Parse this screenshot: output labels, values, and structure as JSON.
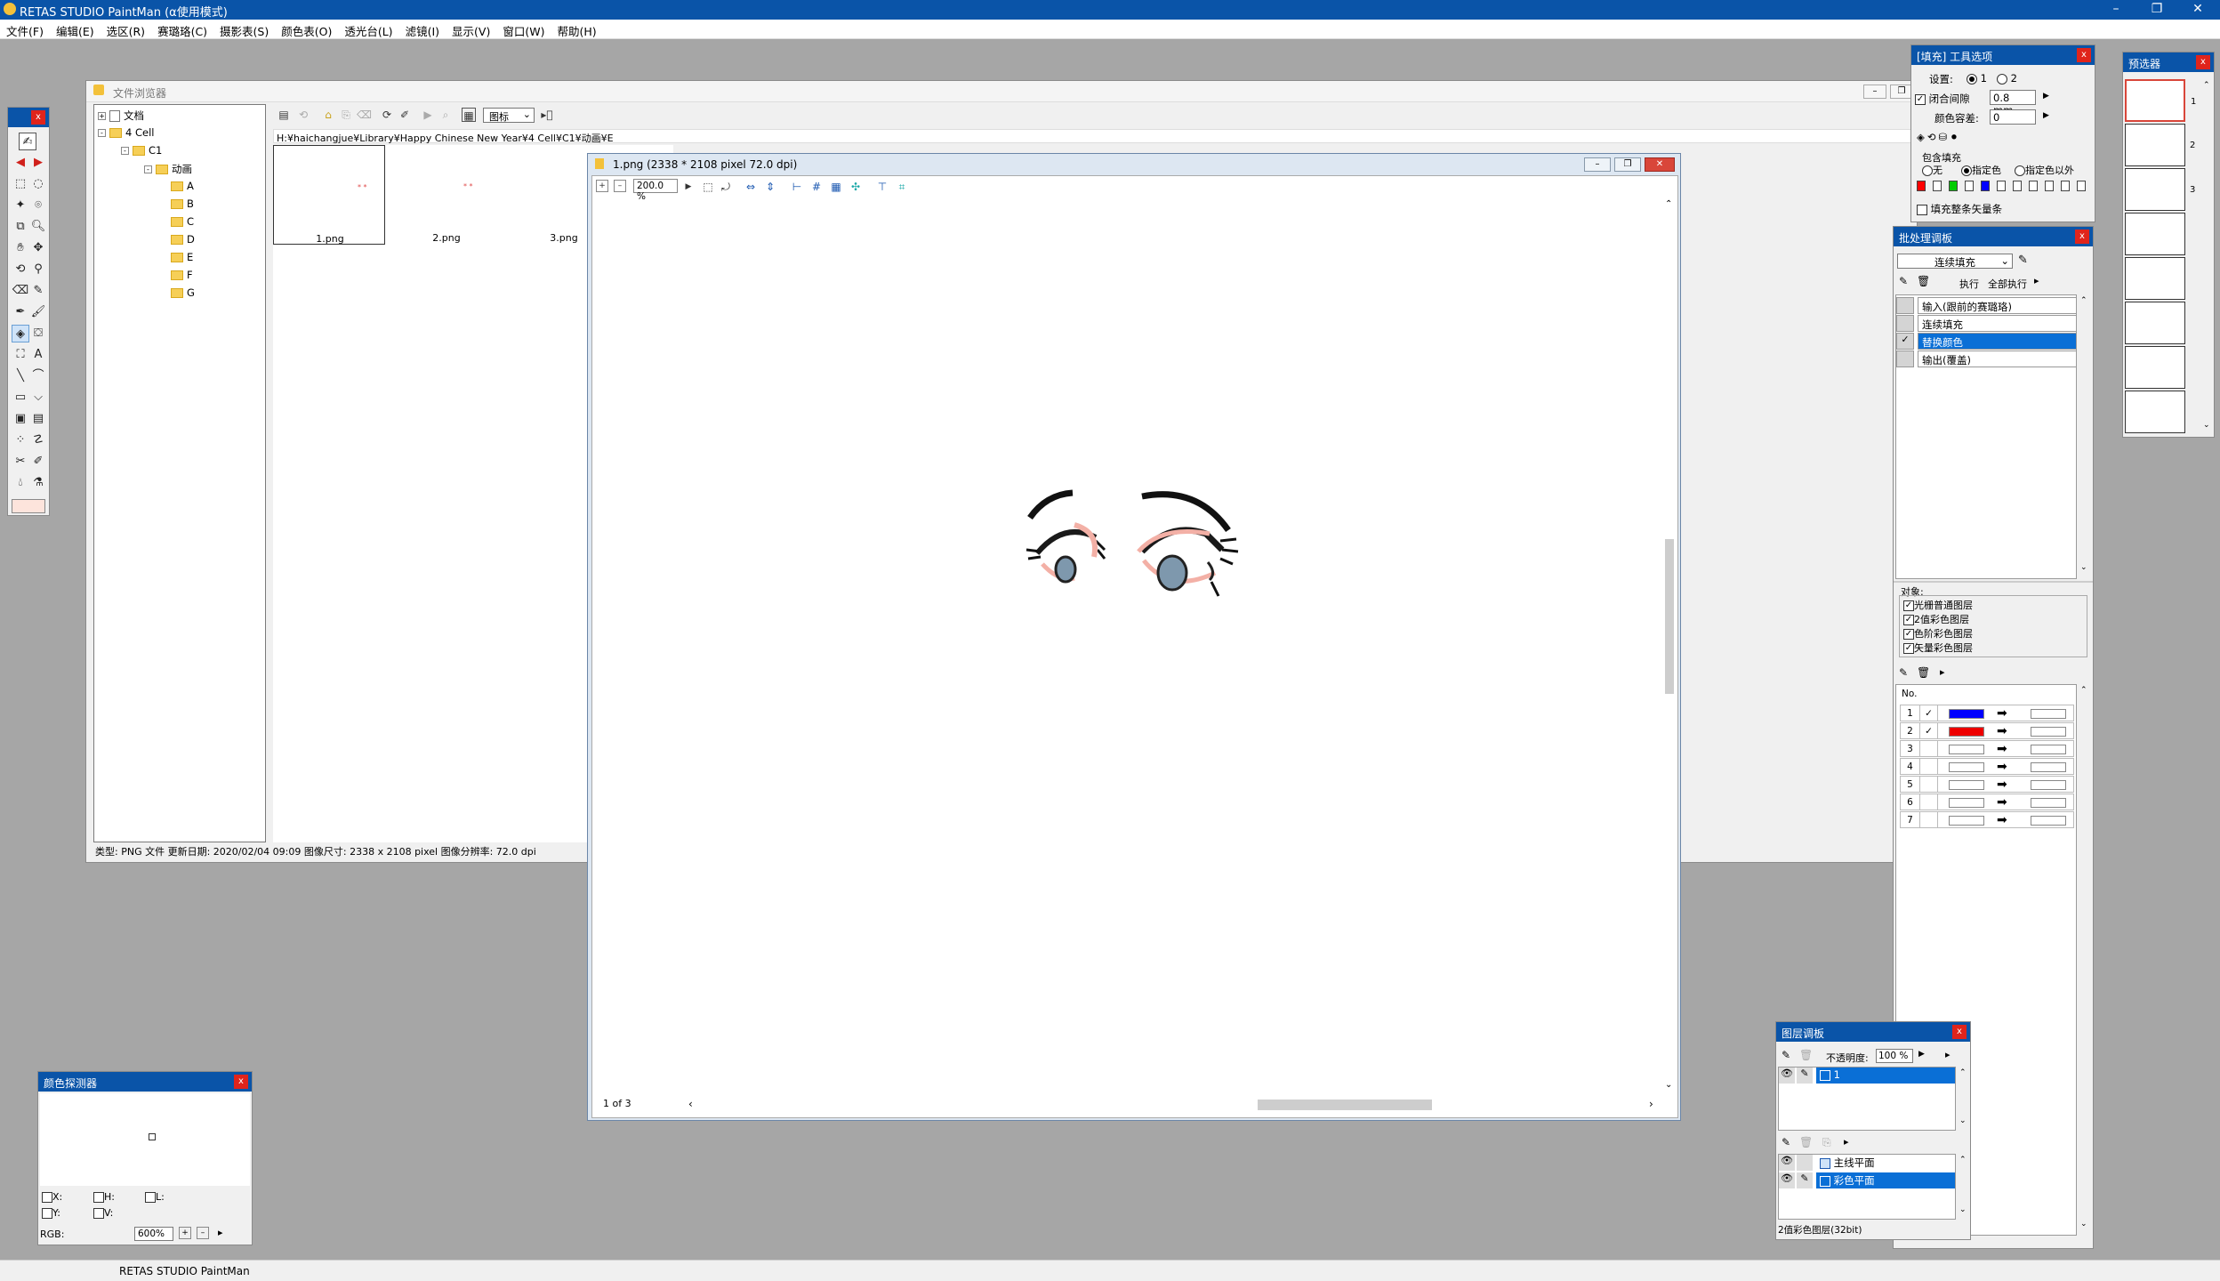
{
  "app": {
    "title": "RETAS STUDIO PaintMan (α使用模式)",
    "status": "RETAS STUDIO PaintMan"
  },
  "menu": [
    "文件(F)",
    "编辑(E)",
    "选区(R)",
    "赛璐珞(C)",
    "摄影表(S)",
    "颜色表(O)",
    "透光台(L)",
    "滤镜(I)",
    "显示(V)",
    "窗口(W)",
    "帮助(H)"
  ],
  "file_browser": {
    "title": "文件浏览器",
    "tree": [
      {
        "label": "文档",
        "level": 0,
        "exp": "+"
      },
      {
        "label": "4 Cell",
        "level": 0,
        "exp": "-"
      },
      {
        "label": "C1",
        "level": 1,
        "exp": "-"
      },
      {
        "label": "动画",
        "level": 2,
        "exp": "-"
      },
      {
        "label": "A",
        "level": 3
      },
      {
        "label": "B",
        "level": 3
      },
      {
        "label": "C",
        "level": 3
      },
      {
        "label": "D",
        "level": 3
      },
      {
        "label": "E",
        "level": 3
      },
      {
        "label": "F",
        "level": 3
      },
      {
        "label": "G",
        "level": 3
      }
    ],
    "view_mode": "图标",
    "path": "H:¥haichangjue¥Library¥Happy Chinese New Year¥4 Cell¥C1¥动画¥E",
    "thumbs": [
      "1.png",
      "2.png",
      "3.png"
    ],
    "info": "类型: PNG 文件   更新日期: 2020/02/04 09:09   图像尺寸: 2338 x 2108 pixel   图像分辨率: 72.0 dpi"
  },
  "image_window": {
    "title": "1.png (2338 * 2108 pixel 72.0 dpi)",
    "zoom": "200.0 %",
    "page": "1 of 3"
  },
  "fill_options": {
    "title": "[填充] 工具选项",
    "setting_label": "设置:",
    "opt1": "1",
    "opt2": "2",
    "close_gap": "闭合间隙",
    "gap_value": "0.8 mm",
    "tolerance_label": "颜色容差:",
    "tolerance_value": "0",
    "include_label": "包含填充",
    "r_none": "无",
    "r_specified": "指定色",
    "r_except": "指定色以外",
    "vector_fill": "填充整条矢量条",
    "colors": [
      "#ff0000",
      "#ffffff",
      "#00cc00",
      "#ffffff",
      "#0000ff",
      "#ffffff",
      "#ffffff",
      "#ffffff",
      "#ffffff",
      "#ffffff",
      "#ffffff"
    ]
  },
  "batch_panel": {
    "title": "批处理调板",
    "mode": "连续填充",
    "exec": "执行",
    "exec_all": "全部执行",
    "steps": [
      "输入(跟前的赛璐珞)",
      "连续填充",
      "替换颜色",
      "输出(覆盖)"
    ],
    "target_label": "对象:",
    "targets": [
      "光栅普通图层",
      "2值彩色图层",
      "色阶彩色图层",
      "矢量彩色图层"
    ],
    "no_label": "No.",
    "rows": [
      {
        "n": "1",
        "check": "✓",
        "color": "#0000ff"
      },
      {
        "n": "2",
        "check": "✓",
        "color": "#ee0000"
      },
      {
        "n": "3",
        "check": "",
        "color": "#ffffff"
      },
      {
        "n": "4",
        "check": "",
        "color": "#ffffff"
      },
      {
        "n": "5",
        "check": "",
        "color": "#ffffff"
      },
      {
        "n": "6",
        "check": "",
        "color": "#ffffff"
      },
      {
        "n": "7",
        "check": "",
        "color": "#ffffff"
      }
    ]
  },
  "preview": {
    "title": "预选器",
    "frames": [
      "1",
      "2",
      "3",
      "",
      "",
      "",
      "",
      ""
    ]
  },
  "layer_panel": {
    "title": "图层调板",
    "opacity_label": "不透明度:",
    "opacity": "100 %",
    "cel": "1",
    "layers": [
      "主线平面",
      "彩色平面"
    ],
    "status": "2值彩色图层(32bit)"
  },
  "color_probe": {
    "title": "颜色探测器",
    "x": "X:",
    "y": "Y:",
    "h": "H:",
    "v": "V:",
    "l": "L:",
    "rgb": "RGB:",
    "zoom": "600%"
  },
  "colors": {
    "title_blue": "#0a54a8",
    "select_blue": "#0a6fd6",
    "close_red": "#e0241b"
  }
}
